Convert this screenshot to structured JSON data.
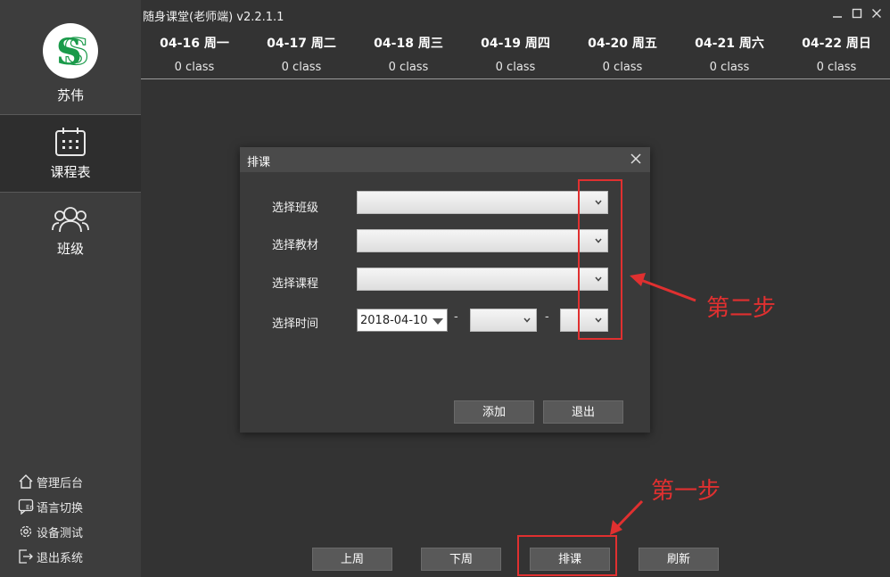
{
  "app": {
    "title": "随身课堂(老师端) v2.2.1.1"
  },
  "user": {
    "name": "苏伟"
  },
  "nav": {
    "items": [
      {
        "label": "课程表"
      },
      {
        "label": "班级"
      }
    ]
  },
  "tools": [
    "管理后台",
    "语言切换",
    "设备测试",
    "退出系统"
  ],
  "days": [
    {
      "date": "04-16 周一",
      "count": "0 class"
    },
    {
      "date": "04-17 周二",
      "count": "0 class"
    },
    {
      "date": "04-18 周三",
      "count": "0 class"
    },
    {
      "date": "04-19 周四",
      "count": "0 class"
    },
    {
      "date": "04-20 周五",
      "count": "0 class"
    },
    {
      "date": "04-21 周六",
      "count": "0 class"
    },
    {
      "date": "04-22 周日",
      "count": "0 class"
    }
  ],
  "dialog": {
    "title": "排课",
    "fields": {
      "class_label": "选择班级",
      "material_label": "选择教材",
      "course_label": "选择课程",
      "time_label": "选择时间"
    },
    "date_value": "2018-04-10",
    "dash": "-",
    "add_button": "添加",
    "exit_button": "退出"
  },
  "bottom_buttons": {
    "prev": "上周",
    "next": "下周",
    "schedule": "排课",
    "refresh": "刷新"
  },
  "annotations": {
    "step1": "第一步",
    "step2": "第二步"
  },
  "colors": {
    "background": "#333333",
    "sidebar": "#3d3d3d",
    "annotation_red": "#e03030",
    "logo_green": "#1a9a4a"
  }
}
